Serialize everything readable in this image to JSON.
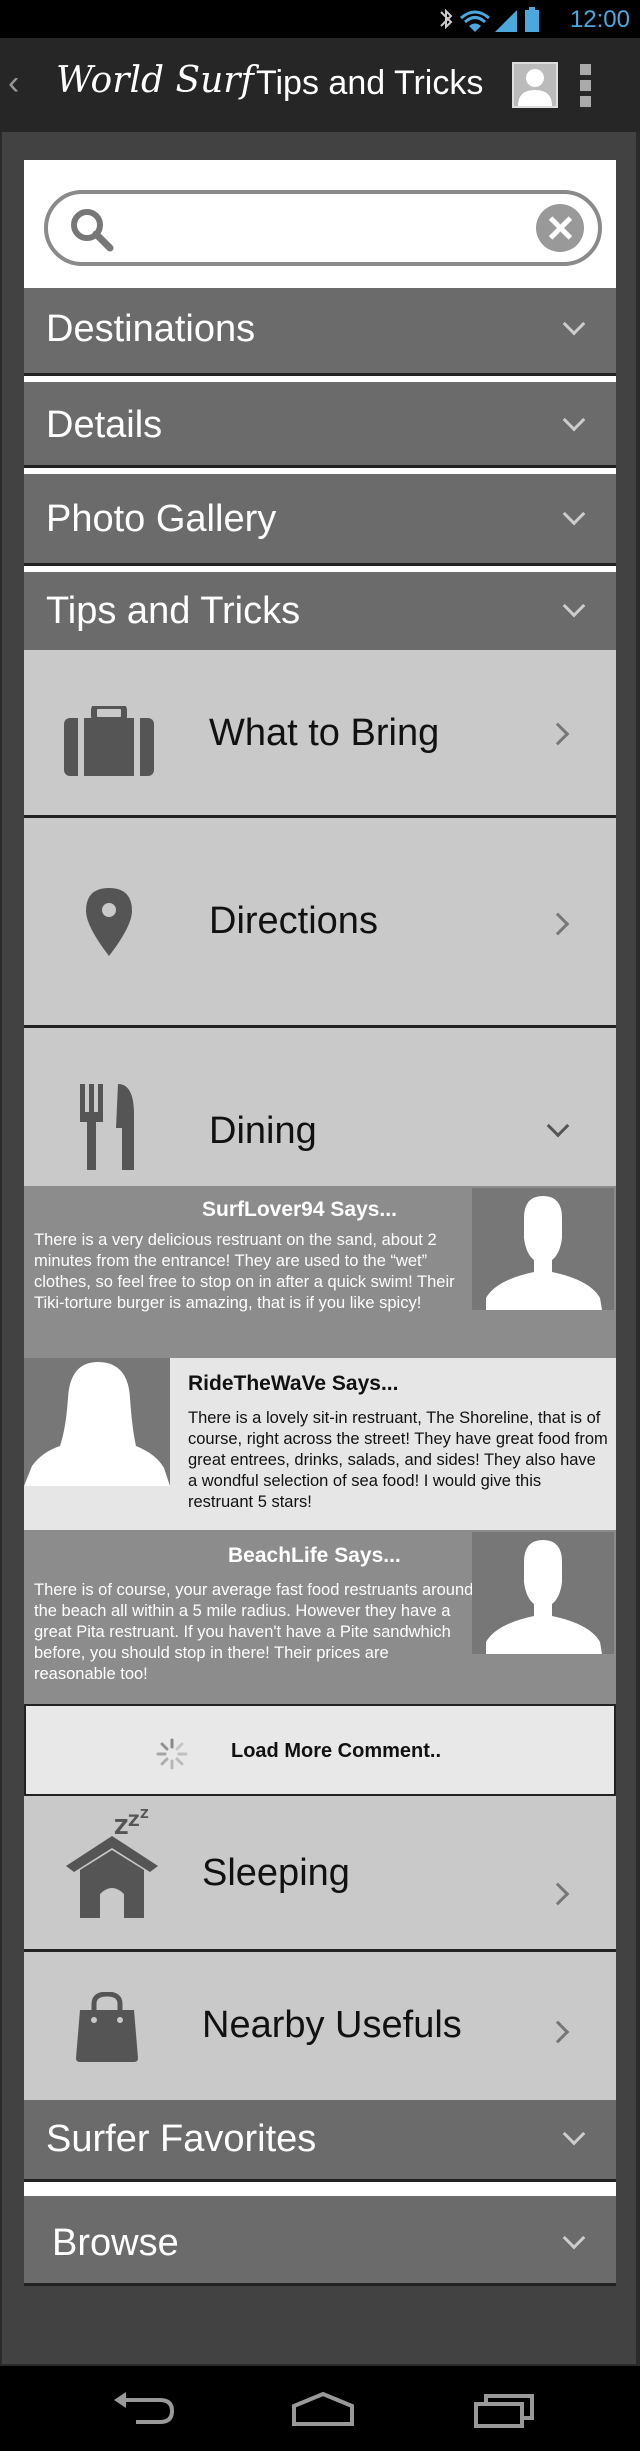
{
  "status_bar": {
    "time": "12:00"
  },
  "app_bar": {
    "back_glyph": "‹",
    "app_title": "World Surf",
    "screen_title": "Tips and Tricks"
  },
  "search": {
    "value": "",
    "placeholder": ""
  },
  "accordion": {
    "destinations": "Destinations",
    "details": "Details",
    "photo_gallery": "Photo Gallery",
    "tips_and_tricks": "Tips and Tricks",
    "surfer_favorites": "Surfer Favorites",
    "browse": "Browse"
  },
  "tips": {
    "what_to_bring": "What to Bring",
    "directions": "Directions",
    "dining": "Dining",
    "sleeping": "Sleeping",
    "nearby_usefuls": "Nearby Usefuls"
  },
  "comments": [
    {
      "author": "SurfLover94 Says...",
      "text": "There is a very delicious restruant on the sand, about 2 minutes from the entrance! They are used to the “wet” clothes, so feel free to stop on in after a quick swim! Their Tiki-torture burger is amazing, that is if you like spicy!"
    },
    {
      "author": "RideTheWaVe Says...",
      "text": "There is a lovely sit-in restruant, The Shoreline, that is of course, right across the street! They have great food from great entrees, drinks, salads, and sides! They also have a wondful selection of sea food! I would give this restruant 5 stars!"
    },
    {
      "author": "BeachLife Says...",
      "text": "There is of course, your average fast food restruants around the beach all within a 5 mile radius. However they have a great Pita restruant. If you haven't have a Pite sandwhich before, you should stop in there! Their prices are reasonable too!"
    }
  ],
  "load_more": "Load More Comment..",
  "icons": {
    "search": "search-icon",
    "clear": "clear-icon",
    "profile": "profile-icon",
    "menu": "overflow-menu-icon",
    "suitcase": "suitcase-icon",
    "pin": "location-pin-icon",
    "fork_knife": "fork-knife-icon",
    "house_zzz": "house-sleep-icon",
    "bag": "shopping-bag-icon"
  }
}
